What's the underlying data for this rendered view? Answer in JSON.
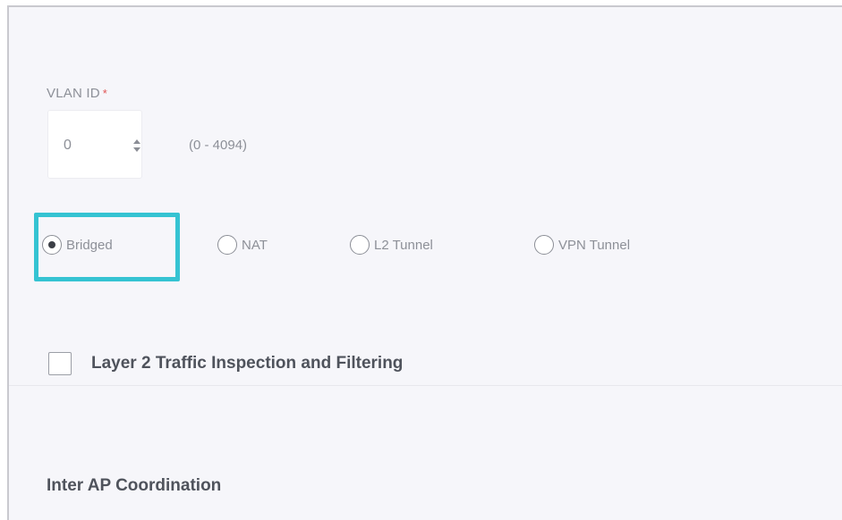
{
  "vlan": {
    "label": "VLAN ID",
    "required_marker": "*",
    "value": "0",
    "range_hint": "(0 - 4094)"
  },
  "forwarding_modes": {
    "selected": "Bridged",
    "options": [
      "Bridged",
      "NAT",
      "L2 Tunnel",
      "VPN Tunnel"
    ]
  },
  "layer2_filtering": {
    "label": "Layer 2 Traffic Inspection and Filtering",
    "checked": false
  },
  "sections": {
    "inter_ap_title": "Inter AP Coordination"
  },
  "colors": {
    "focus_ring": "#35c3d2",
    "panel_bg": "#f6f6fa",
    "required": "#e05555"
  }
}
